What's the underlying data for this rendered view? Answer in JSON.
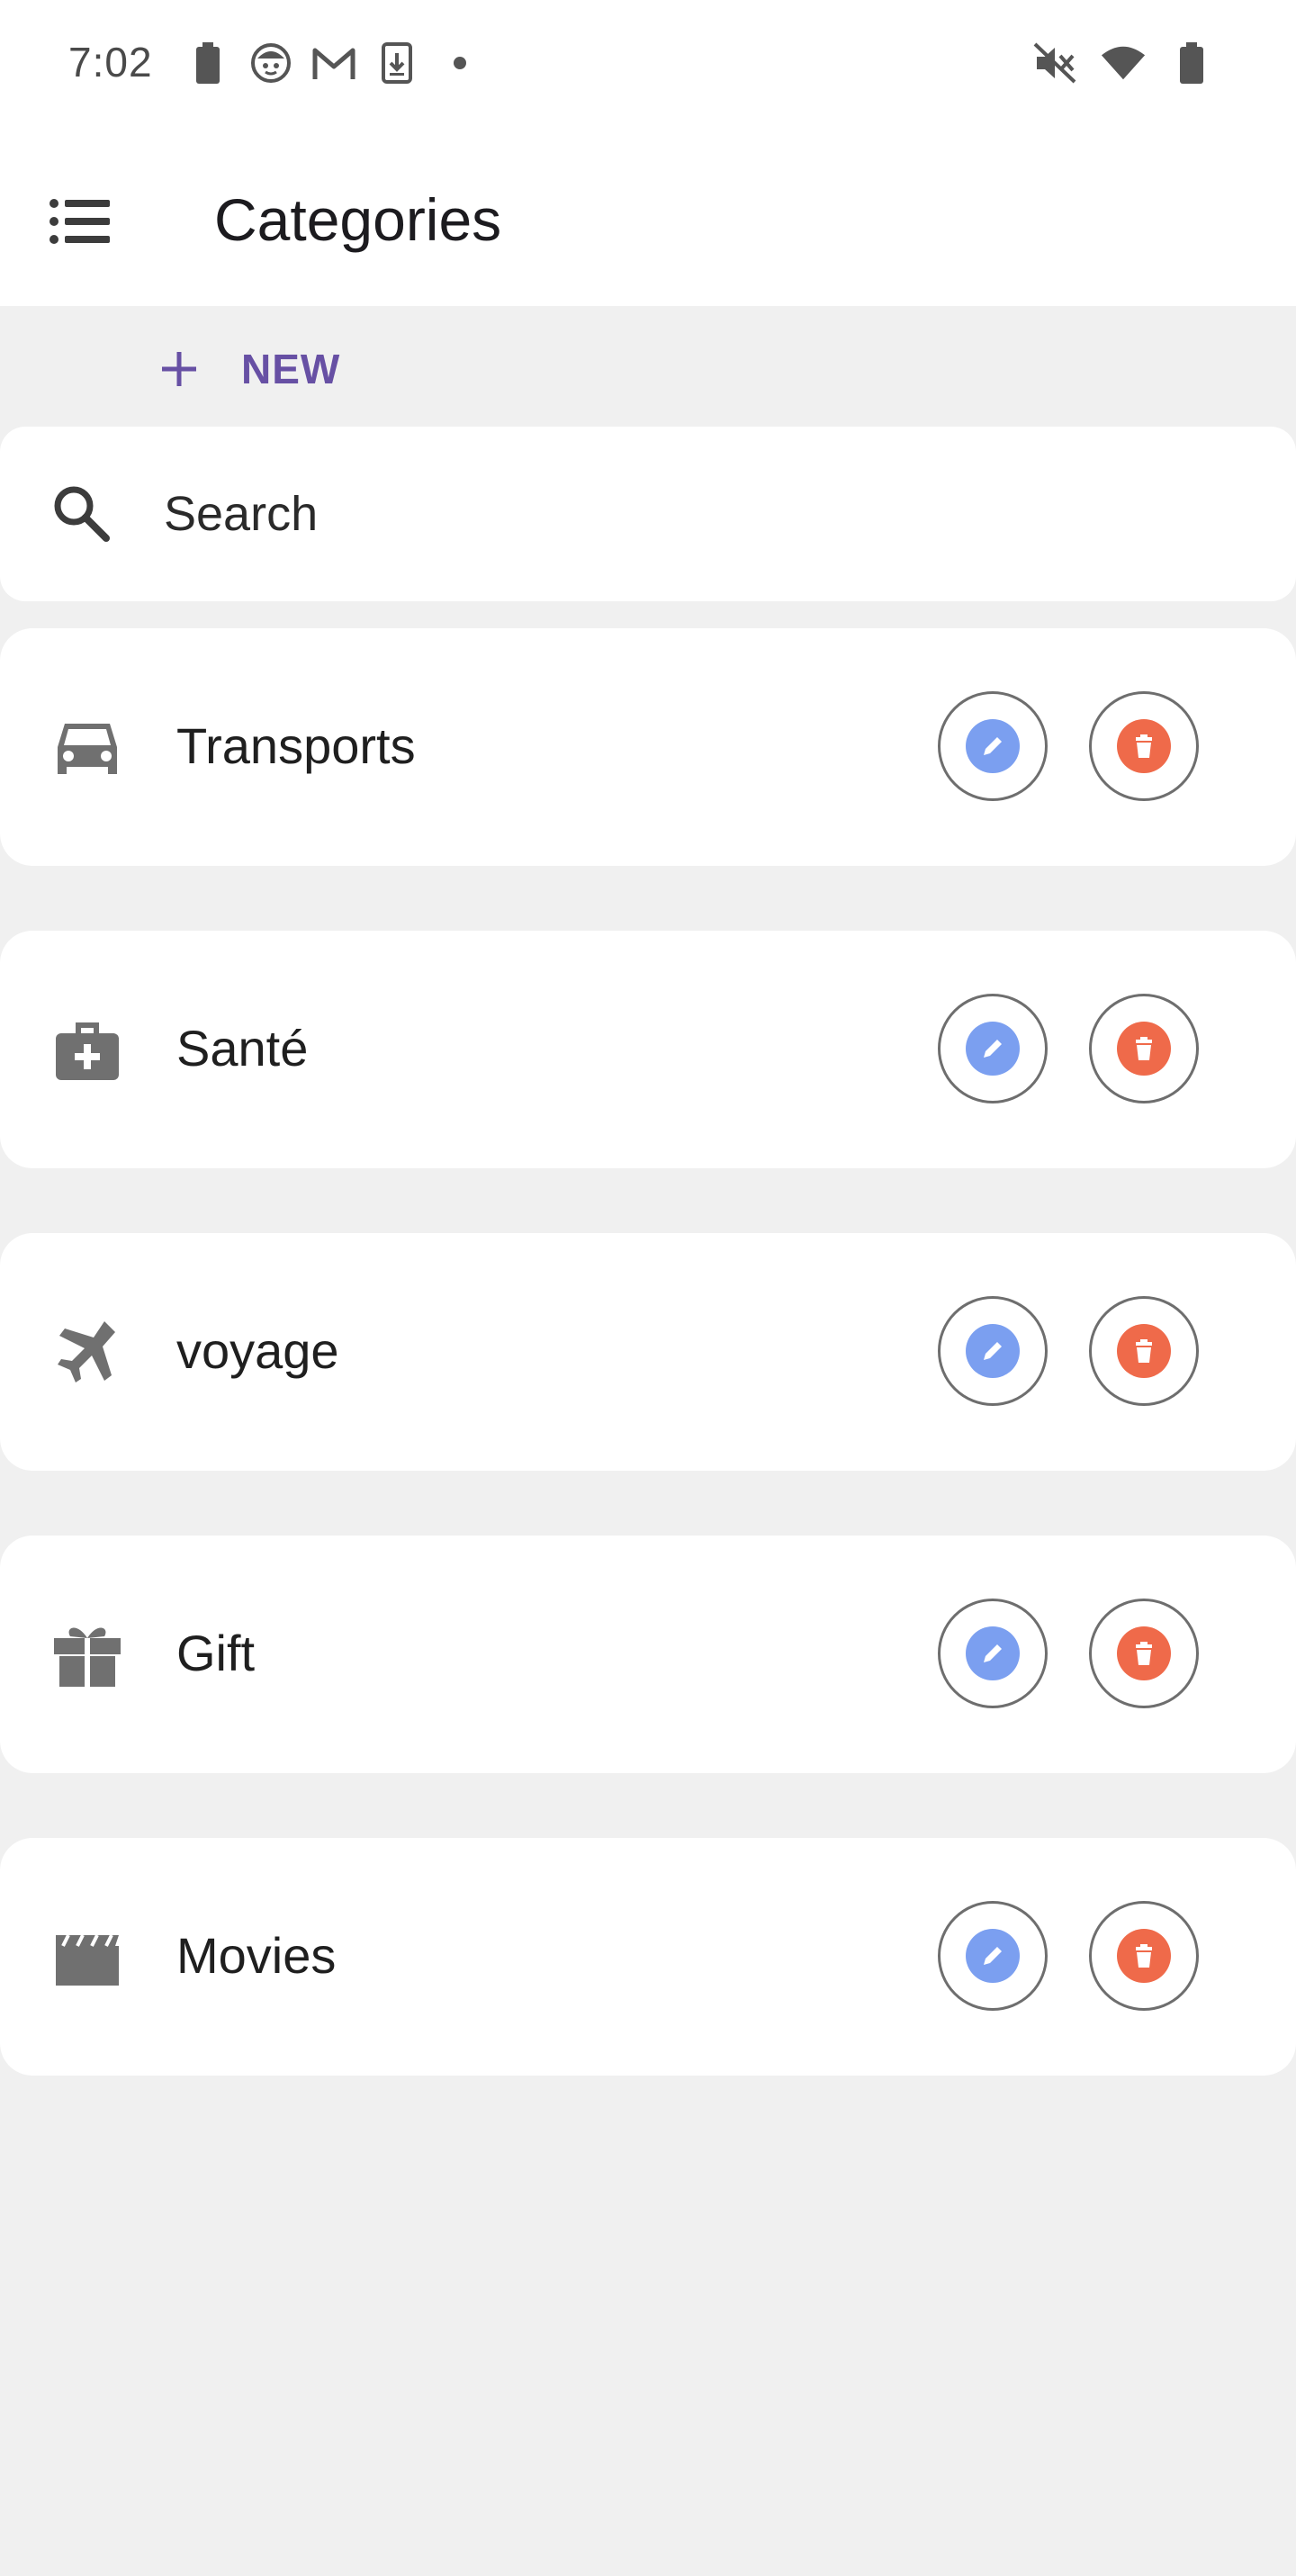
{
  "status_bar": {
    "time": "7:02",
    "left_icons": [
      "battery-icon",
      "face-icon",
      "gmail-icon",
      "download-icon",
      "dot-icon"
    ],
    "right_icons": [
      "mute-icon",
      "wifi-icon",
      "battery-icon"
    ]
  },
  "app_bar": {
    "title": "Categories",
    "menu_icon": "list-menu-icon"
  },
  "new_button": {
    "label": "NEW",
    "icon": "plus-icon"
  },
  "search": {
    "placeholder": "Search",
    "icon": "search-icon"
  },
  "colors": {
    "accent": "#6750a4",
    "edit": "#7b9ff0",
    "delete": "#ef6a4a",
    "icon_gray": "#707070",
    "background": "#f0f0f0"
  },
  "categories": [
    {
      "name": "Transports",
      "icon": "car-icon"
    },
    {
      "name": "Santé",
      "icon": "medical-bag-icon"
    },
    {
      "name": "voyage",
      "icon": "airplane-icon"
    },
    {
      "name": "Gift",
      "icon": "gift-icon"
    },
    {
      "name": "Movies",
      "icon": "clapperboard-icon"
    }
  ]
}
